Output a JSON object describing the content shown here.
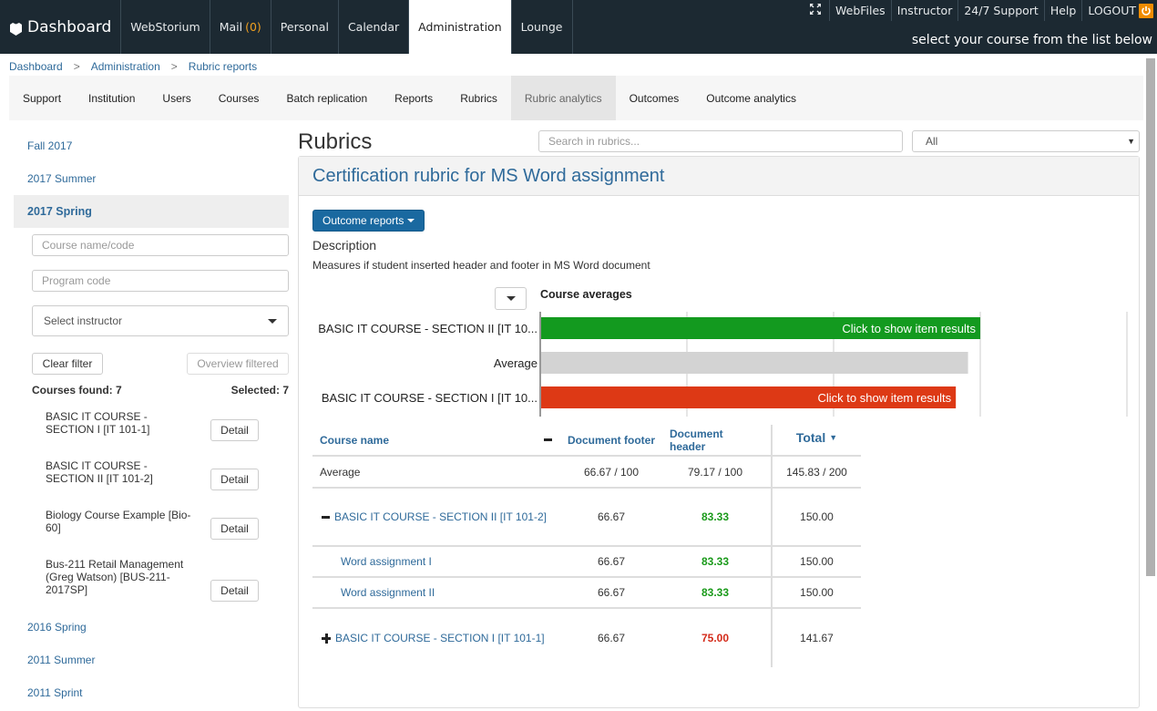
{
  "topbar": {
    "brand": "Dashboard",
    "nav": [
      {
        "label": "WebStorium"
      },
      {
        "label": "Mail",
        "count": "(0)"
      },
      {
        "label": "Personal"
      },
      {
        "label": "Calendar"
      },
      {
        "label": "Administration",
        "active": true
      },
      {
        "label": "Lounge"
      }
    ],
    "links": [
      "WebFiles",
      "Instructor",
      "24/7 Support",
      "Help",
      "LOGOUT"
    ],
    "tagline": "select your course from the list below",
    "colors": {
      "background": "#1c2932",
      "mail_count": "#f0a020",
      "logout_icon": "#f08c00"
    }
  },
  "breadcrumb": [
    "Dashboard",
    "Administration",
    "Rubric reports"
  ],
  "breadcrumb_separator": ">",
  "admin_nav": {
    "tabs": [
      "Support",
      "Institution",
      "Users",
      "Courses",
      "Batch replication",
      "Reports",
      "Rubrics",
      "Rubric analytics",
      "Outcomes",
      "Outcome analytics"
    ],
    "active": "Rubric analytics"
  },
  "sidebar": {
    "terms_top": [
      "Fall 2017",
      "2017 Summer"
    ],
    "active_term": "2017 Spring",
    "filters": {
      "course_placeholder": "Course name/code",
      "program_placeholder": "Program code",
      "instructor_placeholder": "Select instructor"
    },
    "clear_filter": "Clear filter",
    "overview_filtered": "Overview filtered",
    "courses_found_label": "Courses found: 7",
    "selected_label": "Selected: 7",
    "courses": [
      {
        "name": "BASIC IT COURSE - SECTION I [IT 101-1]",
        "lines": [
          "BASIC IT COURSE -",
          "SECTION I [IT 101-1]"
        ],
        "button": "Detail"
      },
      {
        "name": "BASIC IT COURSE - SECTION II [IT 101-2]",
        "lines": [
          "BASIC IT COURSE -",
          "SECTION II [IT 101-2]"
        ],
        "button": "Detail"
      },
      {
        "name": "Biology Course Example [Bio-60]",
        "lines": [
          "Biology Course Example [Bio-",
          "60]"
        ],
        "button": "Detail"
      },
      {
        "name": "Bus-211 Retail Management (Greg Watson) [BUS-211-2017SP]",
        "lines": [
          "Bus-211 Retail Management",
          "(Greg Watson) [BUS-211-",
          "2017SP]"
        ],
        "button": "Detail"
      }
    ],
    "terms_bottom": [
      "2016 Spring",
      "2011 Summer",
      "2011 Sprint"
    ]
  },
  "main": {
    "title": "Rubrics",
    "search_placeholder": "Search in rubrics...",
    "filter_value": "All",
    "rubric_title": "Certification rubric for MS Word assignment",
    "outcome_reports_label": "Outcome reports",
    "description_title": "Description",
    "description_text": "Measures if student inserted header and footer in MS Word document"
  },
  "chart_data": {
    "type": "bar",
    "orientation": "horizontal",
    "title": "Course averages",
    "categories": [
      "BASIC IT COURSE - SECTION II [IT 10...",
      "Average",
      "BASIC IT COURSE - SECTION I [IT 10..."
    ],
    "values": [
      150.0,
      145.83,
      141.67
    ],
    "colors": [
      "#139a1f",
      "#d3d3d3",
      "#dd3915"
    ],
    "bar_labels": [
      "Click to show item results",
      "",
      "Click to show item results"
    ],
    "xlim": [
      0,
      200
    ],
    "gridlines": [
      50,
      100,
      150,
      200
    ],
    "grid": true,
    "xlabel": "",
    "ylabel": ""
  },
  "table": {
    "headers": {
      "name": "Course name",
      "footer": "Document footer",
      "header": "Document header",
      "total": "Total"
    },
    "average": {
      "name": "Average",
      "footer": "66.67 / 100",
      "header": "79.17 / 100",
      "total": "145.83 / 200"
    },
    "rows": [
      {
        "type": "course",
        "expanded": true,
        "name": "BASIC IT COURSE - SECTION II [IT 101-2]",
        "footer": "66.67",
        "header": "83.33",
        "header_status": "good",
        "total": "150.00"
      },
      {
        "type": "item",
        "name": "Word assignment I",
        "footer": "66.67",
        "header": "83.33",
        "header_status": "good",
        "total": "150.00"
      },
      {
        "type": "item",
        "name": "Word assignment II",
        "footer": "66.67",
        "header": "83.33",
        "header_status": "good",
        "total": "150.00"
      },
      {
        "type": "course",
        "expanded": false,
        "name": "BASIC IT COURSE - SECTION I [IT 101-1]",
        "footer": "66.67",
        "header": "75.00",
        "header_status": "bad",
        "total": "141.67"
      }
    ]
  }
}
